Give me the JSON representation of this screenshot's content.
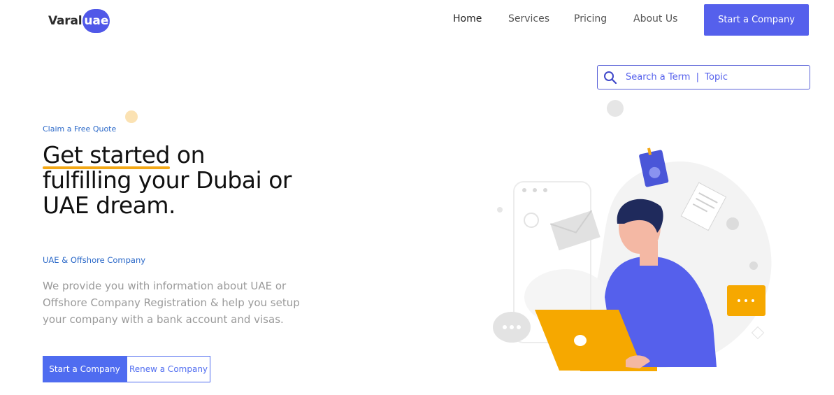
{
  "header": {
    "logo_text": "Varal",
    "logo_badge": "uae",
    "nav": [
      {
        "label": "Home",
        "active": true
      },
      {
        "label": "Services",
        "active": false
      },
      {
        "label": "Pricing",
        "active": false
      },
      {
        "label": "About Us",
        "active": false
      }
    ],
    "cta_label": "Start a Company"
  },
  "search": {
    "placeholder": "Search a Term  |  Topic",
    "icon": "search-icon"
  },
  "hero": {
    "eyebrow": "Claim a Free Quote",
    "title_highlight": "Get started",
    "title_rest_1": " on",
    "title_line_2": "fulfilling your Dubai or",
    "title_line_3": "UAE dream.",
    "sub_label": "UAE & Offshore Company",
    "description": "We provide you with information about UAE or Offshore Company Registration & help you setup your company with a bank account and visas.",
    "primary_button": "Start a Company",
    "secondary_button": "Renew a Company"
  },
  "colors": {
    "accent": "#5560ec",
    "highlight": "#f3a816",
    "link_blue": "#2a68c8",
    "laptop": "#f6a800",
    "shirt": "#5560ec"
  }
}
